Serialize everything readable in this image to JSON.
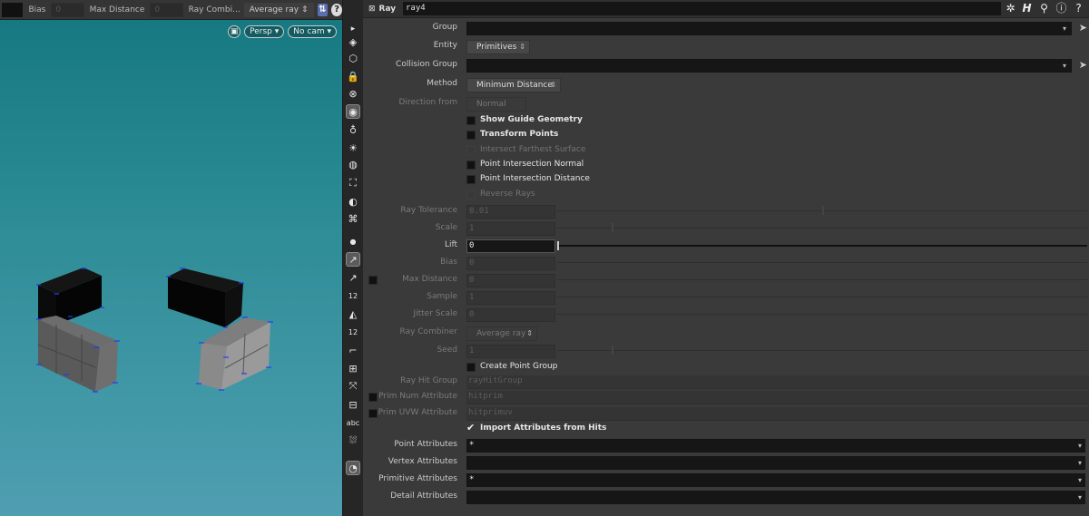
{
  "viewport": {
    "opbar": {
      "bias_label": "Bias",
      "bias_value": "0",
      "maxdist_label": "Max Distance",
      "maxdist_value": "0",
      "raycomb_label": "Ray Combi...",
      "raycomb_value": "Average ray"
    },
    "persp_label": "Persp",
    "cam_label": "No cam"
  },
  "toolbar": {
    "num_label_1": "12",
    "num_label_2": "12",
    "abc_label": "abc"
  },
  "header": {
    "node_type": "Ray",
    "node_name": "ray4",
    "icons": [
      "gear-icon",
      "houdini-h-icon",
      "search-icon",
      "info-icon",
      "help-icon"
    ]
  },
  "params": {
    "group": {
      "label": "Group",
      "value": ""
    },
    "entity": {
      "label": "Entity",
      "value": "Primitives"
    },
    "collision_group": {
      "label": "Collision Group",
      "value": ""
    },
    "method": {
      "label": "Method",
      "value": "Minimum Distance"
    },
    "direction_from": {
      "label": "Direction from",
      "value": "Normal"
    },
    "show_guide": {
      "label": "Show Guide Geometry",
      "checked": false
    },
    "transform_points": {
      "label": "Transform Points",
      "checked": false
    },
    "intersect_farthest": {
      "label": "Intersect Farthest Surface",
      "checked": false
    },
    "point_int_normal": {
      "label": "Point Intersection Normal",
      "checked": false
    },
    "point_int_distance": {
      "label": "Point Intersection Distance",
      "checked": false
    },
    "reverse_rays": {
      "label": "Reverse Rays",
      "checked": false
    },
    "ray_tolerance": {
      "label": "Ray Tolerance",
      "value": "0.01"
    },
    "scale": {
      "label": "Scale",
      "value": "1"
    },
    "lift": {
      "label": "Lift",
      "value": "0"
    },
    "bias": {
      "label": "Bias",
      "value": "0"
    },
    "max_distance": {
      "label": "Max Distance",
      "value": "0"
    },
    "sample": {
      "label": "Sample",
      "value": "1"
    },
    "jitter_scale": {
      "label": "Jitter Scale",
      "value": "0"
    },
    "ray_combiner": {
      "label": "Ray Combiner",
      "value": "Average ray"
    },
    "seed": {
      "label": "Seed",
      "value": "1"
    },
    "create_point_group": {
      "label": "Create Point Group",
      "checked": false
    },
    "ray_hit_group": {
      "label": "Ray Hit Group",
      "value": "rayHitGroup"
    },
    "prim_num_attr": {
      "label": "Prim Num Attribute",
      "value": "hitprim"
    },
    "prim_uvw_attr": {
      "label": "Prim UVW Attribute",
      "value": "hitprimuv"
    },
    "import_attrs": {
      "label": "Import Attributes from Hits",
      "checked": true
    },
    "point_attrs": {
      "label": "Point Attributes",
      "value": "*"
    },
    "vertex_attrs": {
      "label": "Vertex Attributes",
      "value": ""
    },
    "primitive_attrs": {
      "label": "Primitive Attributes",
      "value": "*"
    },
    "detail_attrs": {
      "label": "Detail Attributes",
      "value": ""
    }
  },
  "colors": {
    "viewport_top": "#14777f",
    "viewport_bottom": "#4f9fb1",
    "panel_bg": "#3a3a3a",
    "field_bg": "#161616",
    "accent_blue": "#1f3cff"
  }
}
